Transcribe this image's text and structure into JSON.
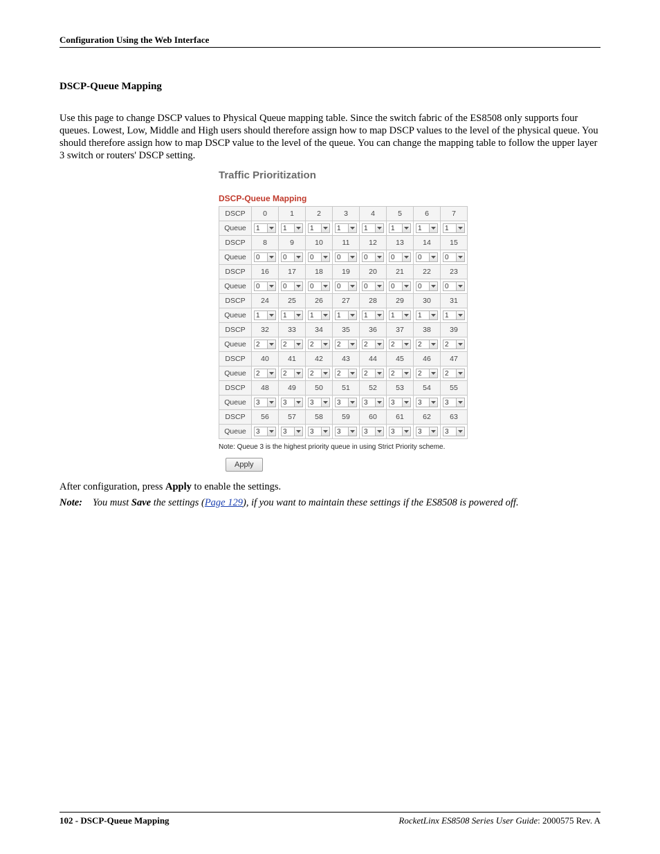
{
  "header": "Configuration Using the Web Interface",
  "section_title": "DSCP-Queue Mapping",
  "body_text": "Use this page to change DSCP values to Physical Queue mapping table. Since the switch fabric of the ES8508 only supports four queues. Lowest, Low, Middle and High users should therefore assign how to map DSCP values to the level of the physical queue. You should therefore assign how to map DSCP value to the level of the queue. You can change the mapping table to follow the upper layer 3 switch or routers' DSCP setting.",
  "ui": {
    "title": "Traffic Prioritization",
    "subtitle": "DSCP-Queue Mapping",
    "row_label_dscp": "DSCP",
    "row_label_queue": "Queue",
    "groups": [
      {
        "dscp": [
          0,
          1,
          2,
          3,
          4,
          5,
          6,
          7
        ],
        "queue": [
          1,
          1,
          1,
          1,
          1,
          1,
          1,
          1
        ]
      },
      {
        "dscp": [
          8,
          9,
          10,
          11,
          12,
          13,
          14,
          15
        ],
        "queue": [
          0,
          0,
          0,
          0,
          0,
          0,
          0,
          0
        ]
      },
      {
        "dscp": [
          16,
          17,
          18,
          19,
          20,
          21,
          22,
          23
        ],
        "queue": [
          0,
          0,
          0,
          0,
          0,
          0,
          0,
          0
        ]
      },
      {
        "dscp": [
          24,
          25,
          26,
          27,
          28,
          29,
          30,
          31
        ],
        "queue": [
          1,
          1,
          1,
          1,
          1,
          1,
          1,
          1
        ]
      },
      {
        "dscp": [
          32,
          33,
          34,
          35,
          36,
          37,
          38,
          39
        ],
        "queue": [
          2,
          2,
          2,
          2,
          2,
          2,
          2,
          2
        ]
      },
      {
        "dscp": [
          40,
          41,
          42,
          43,
          44,
          45,
          46,
          47
        ],
        "queue": [
          2,
          2,
          2,
          2,
          2,
          2,
          2,
          2
        ]
      },
      {
        "dscp": [
          48,
          49,
          50,
          51,
          52,
          53,
          54,
          55
        ],
        "queue": [
          3,
          3,
          3,
          3,
          3,
          3,
          3,
          3
        ]
      },
      {
        "dscp": [
          56,
          57,
          58,
          59,
          60,
          61,
          62,
          63
        ],
        "queue": [
          3,
          3,
          3,
          3,
          3,
          3,
          3,
          3
        ]
      }
    ],
    "note": "Note: Queue 3 is the highest priority queue in using Strict Priority scheme.",
    "apply": "Apply"
  },
  "after_text_pre": "After configuration, press ",
  "after_text_bold": "Apply",
  "after_text_post": " to enable the settings.",
  "note_label": "Note:",
  "note_pre": "You must ",
  "note_bold": "Save",
  "note_mid": " the settings (",
  "note_link": "Page 129",
  "note_post": "), if you want to maintain these settings if the ES8508 is powered off.",
  "footer": {
    "page_num": "102",
    "page_title": "DSCP-Queue Mapping",
    "guide": "RocketLinx ES8508 Series  User Guide",
    "rev": ": 2000575 Rev. A"
  }
}
